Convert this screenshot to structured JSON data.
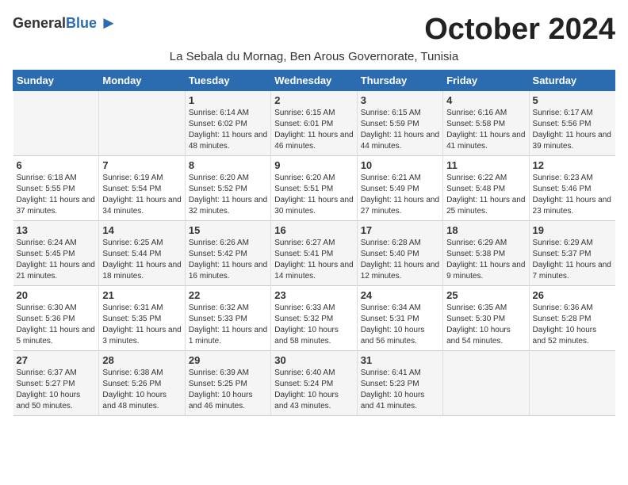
{
  "header": {
    "logo_general": "General",
    "logo_blue": "Blue",
    "month_title": "October 2024",
    "subtitle": "La Sebala du Mornag, Ben Arous Governorate, Tunisia"
  },
  "days_of_week": [
    "Sunday",
    "Monday",
    "Tuesday",
    "Wednesday",
    "Thursday",
    "Friday",
    "Saturday"
  ],
  "weeks": [
    [
      {
        "day": "",
        "info": ""
      },
      {
        "day": "",
        "info": ""
      },
      {
        "day": "1",
        "info": "Sunrise: 6:14 AM\nSunset: 6:02 PM\nDaylight: 11 hours and 48 minutes."
      },
      {
        "day": "2",
        "info": "Sunrise: 6:15 AM\nSunset: 6:01 PM\nDaylight: 11 hours and 46 minutes."
      },
      {
        "day": "3",
        "info": "Sunrise: 6:15 AM\nSunset: 5:59 PM\nDaylight: 11 hours and 44 minutes."
      },
      {
        "day": "4",
        "info": "Sunrise: 6:16 AM\nSunset: 5:58 PM\nDaylight: 11 hours and 41 minutes."
      },
      {
        "day": "5",
        "info": "Sunrise: 6:17 AM\nSunset: 5:56 PM\nDaylight: 11 hours and 39 minutes."
      }
    ],
    [
      {
        "day": "6",
        "info": "Sunrise: 6:18 AM\nSunset: 5:55 PM\nDaylight: 11 hours and 37 minutes."
      },
      {
        "day": "7",
        "info": "Sunrise: 6:19 AM\nSunset: 5:54 PM\nDaylight: 11 hours and 34 minutes."
      },
      {
        "day": "8",
        "info": "Sunrise: 6:20 AM\nSunset: 5:52 PM\nDaylight: 11 hours and 32 minutes."
      },
      {
        "day": "9",
        "info": "Sunrise: 6:20 AM\nSunset: 5:51 PM\nDaylight: 11 hours and 30 minutes."
      },
      {
        "day": "10",
        "info": "Sunrise: 6:21 AM\nSunset: 5:49 PM\nDaylight: 11 hours and 27 minutes."
      },
      {
        "day": "11",
        "info": "Sunrise: 6:22 AM\nSunset: 5:48 PM\nDaylight: 11 hours and 25 minutes."
      },
      {
        "day": "12",
        "info": "Sunrise: 6:23 AM\nSunset: 5:46 PM\nDaylight: 11 hours and 23 minutes."
      }
    ],
    [
      {
        "day": "13",
        "info": "Sunrise: 6:24 AM\nSunset: 5:45 PM\nDaylight: 11 hours and 21 minutes."
      },
      {
        "day": "14",
        "info": "Sunrise: 6:25 AM\nSunset: 5:44 PM\nDaylight: 11 hours and 18 minutes."
      },
      {
        "day": "15",
        "info": "Sunrise: 6:26 AM\nSunset: 5:42 PM\nDaylight: 11 hours and 16 minutes."
      },
      {
        "day": "16",
        "info": "Sunrise: 6:27 AM\nSunset: 5:41 PM\nDaylight: 11 hours and 14 minutes."
      },
      {
        "day": "17",
        "info": "Sunrise: 6:28 AM\nSunset: 5:40 PM\nDaylight: 11 hours and 12 minutes."
      },
      {
        "day": "18",
        "info": "Sunrise: 6:29 AM\nSunset: 5:38 PM\nDaylight: 11 hours and 9 minutes."
      },
      {
        "day": "19",
        "info": "Sunrise: 6:29 AM\nSunset: 5:37 PM\nDaylight: 11 hours and 7 minutes."
      }
    ],
    [
      {
        "day": "20",
        "info": "Sunrise: 6:30 AM\nSunset: 5:36 PM\nDaylight: 11 hours and 5 minutes."
      },
      {
        "day": "21",
        "info": "Sunrise: 6:31 AM\nSunset: 5:35 PM\nDaylight: 11 hours and 3 minutes."
      },
      {
        "day": "22",
        "info": "Sunrise: 6:32 AM\nSunset: 5:33 PM\nDaylight: 11 hours and 1 minute."
      },
      {
        "day": "23",
        "info": "Sunrise: 6:33 AM\nSunset: 5:32 PM\nDaylight: 10 hours and 58 minutes."
      },
      {
        "day": "24",
        "info": "Sunrise: 6:34 AM\nSunset: 5:31 PM\nDaylight: 10 hours and 56 minutes."
      },
      {
        "day": "25",
        "info": "Sunrise: 6:35 AM\nSunset: 5:30 PM\nDaylight: 10 hours and 54 minutes."
      },
      {
        "day": "26",
        "info": "Sunrise: 6:36 AM\nSunset: 5:28 PM\nDaylight: 10 hours and 52 minutes."
      }
    ],
    [
      {
        "day": "27",
        "info": "Sunrise: 6:37 AM\nSunset: 5:27 PM\nDaylight: 10 hours and 50 minutes."
      },
      {
        "day": "28",
        "info": "Sunrise: 6:38 AM\nSunset: 5:26 PM\nDaylight: 10 hours and 48 minutes."
      },
      {
        "day": "29",
        "info": "Sunrise: 6:39 AM\nSunset: 5:25 PM\nDaylight: 10 hours and 46 minutes."
      },
      {
        "day": "30",
        "info": "Sunrise: 6:40 AM\nSunset: 5:24 PM\nDaylight: 10 hours and 43 minutes."
      },
      {
        "day": "31",
        "info": "Sunrise: 6:41 AM\nSunset: 5:23 PM\nDaylight: 10 hours and 41 minutes."
      },
      {
        "day": "",
        "info": ""
      },
      {
        "day": "",
        "info": ""
      }
    ]
  ]
}
